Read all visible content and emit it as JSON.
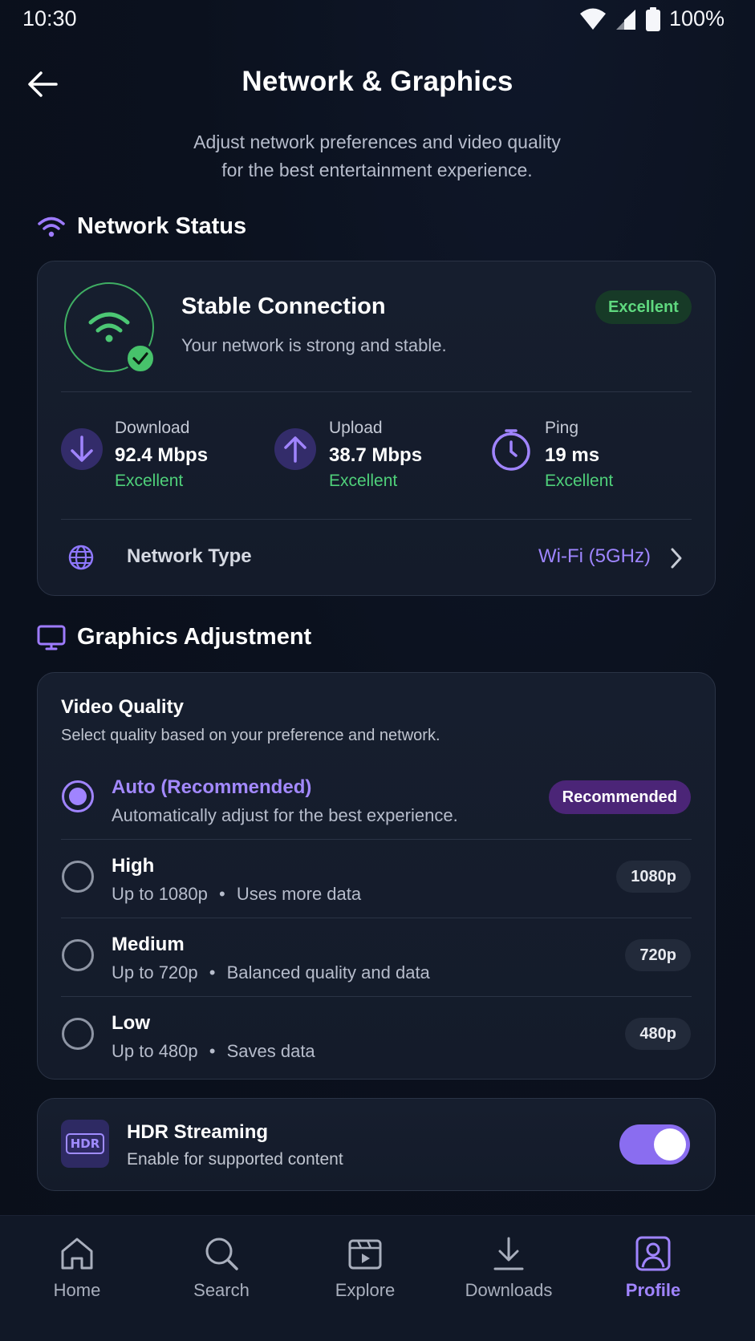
{
  "status_bar": {
    "time": "10:30",
    "battery": "100%"
  },
  "header": {
    "title": "Network & Graphics",
    "subtitle_line1": "Adjust network preferences and video quality",
    "subtitle_line2": "for the best entertainment experience."
  },
  "network_status": {
    "section_title": "Network Status",
    "connection_title": "Stable Connection",
    "connection_sub": "Your network is strong and stable.",
    "badge": "Excellent",
    "stats": [
      {
        "label": "Download",
        "value": "92.4 Mbps",
        "rating": "Excellent"
      },
      {
        "label": "Upload",
        "value": "38.7 Mbps",
        "rating": "Excellent"
      },
      {
        "label": "Ping",
        "value": "19 ms",
        "rating": "Excellent"
      }
    ],
    "network_type_label": "Network Type",
    "network_type_value": "Wi-Fi (5GHz)"
  },
  "graphics": {
    "section_title": "Graphics Adjustment",
    "vq_title": "Video Quality",
    "vq_sub": "Select quality based on your preference and network.",
    "options": [
      {
        "title": "Auto (Recommended)",
        "desc": "Automatically adjust for the best experience.",
        "badge": "Recommended",
        "selected": true
      },
      {
        "title": "High",
        "desc_res": "Up to 1080p",
        "desc_note": "Uses more data",
        "badge": "1080p",
        "selected": false
      },
      {
        "title": "Medium",
        "desc_res": "Up to 720p",
        "desc_note": "Balanced quality and data",
        "badge": "720p",
        "selected": false
      },
      {
        "title": "Low",
        "desc_res": "Up to 480p",
        "desc_note": "Saves data",
        "badge": "480p",
        "selected": false
      }
    ],
    "bullet": "•"
  },
  "hdr": {
    "icon_text": "HDR",
    "title": "HDR Streaming",
    "sub": "Enable for supported content",
    "enabled": true
  },
  "nav": {
    "items": [
      {
        "label": "Home"
      },
      {
        "label": "Search"
      },
      {
        "label": "Explore"
      },
      {
        "label": "Downloads"
      },
      {
        "label": "Profile"
      }
    ],
    "active": "Profile"
  },
  "colors": {
    "accent": "#a084ff",
    "success": "#4fd07a",
    "background": "#0b111e",
    "card": "#161e2e"
  }
}
